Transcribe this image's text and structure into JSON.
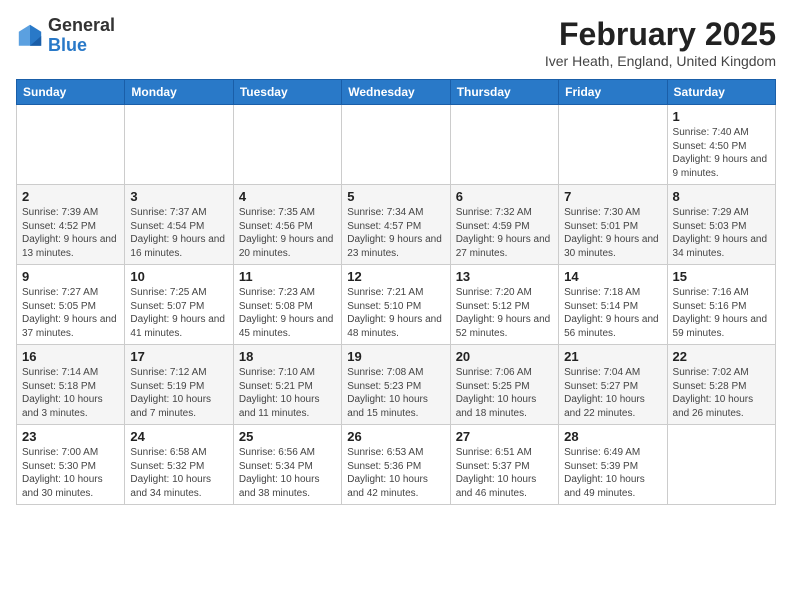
{
  "header": {
    "logo_general": "General",
    "logo_blue": "Blue",
    "month_title": "February 2025",
    "location": "Iver Heath, England, United Kingdom"
  },
  "weekdays": [
    "Sunday",
    "Monday",
    "Tuesday",
    "Wednesday",
    "Thursday",
    "Friday",
    "Saturday"
  ],
  "weeks": [
    [
      {
        "day": "",
        "info": ""
      },
      {
        "day": "",
        "info": ""
      },
      {
        "day": "",
        "info": ""
      },
      {
        "day": "",
        "info": ""
      },
      {
        "day": "",
        "info": ""
      },
      {
        "day": "",
        "info": ""
      },
      {
        "day": "1",
        "info": "Sunrise: 7:40 AM\nSunset: 4:50 PM\nDaylight: 9 hours and 9 minutes."
      }
    ],
    [
      {
        "day": "2",
        "info": "Sunrise: 7:39 AM\nSunset: 4:52 PM\nDaylight: 9 hours and 13 minutes."
      },
      {
        "day": "3",
        "info": "Sunrise: 7:37 AM\nSunset: 4:54 PM\nDaylight: 9 hours and 16 minutes."
      },
      {
        "day": "4",
        "info": "Sunrise: 7:35 AM\nSunset: 4:56 PM\nDaylight: 9 hours and 20 minutes."
      },
      {
        "day": "5",
        "info": "Sunrise: 7:34 AM\nSunset: 4:57 PM\nDaylight: 9 hours and 23 minutes."
      },
      {
        "day": "6",
        "info": "Sunrise: 7:32 AM\nSunset: 4:59 PM\nDaylight: 9 hours and 27 minutes."
      },
      {
        "day": "7",
        "info": "Sunrise: 7:30 AM\nSunset: 5:01 PM\nDaylight: 9 hours and 30 minutes."
      },
      {
        "day": "8",
        "info": "Sunrise: 7:29 AM\nSunset: 5:03 PM\nDaylight: 9 hours and 34 minutes."
      }
    ],
    [
      {
        "day": "9",
        "info": "Sunrise: 7:27 AM\nSunset: 5:05 PM\nDaylight: 9 hours and 37 minutes."
      },
      {
        "day": "10",
        "info": "Sunrise: 7:25 AM\nSunset: 5:07 PM\nDaylight: 9 hours and 41 minutes."
      },
      {
        "day": "11",
        "info": "Sunrise: 7:23 AM\nSunset: 5:08 PM\nDaylight: 9 hours and 45 minutes."
      },
      {
        "day": "12",
        "info": "Sunrise: 7:21 AM\nSunset: 5:10 PM\nDaylight: 9 hours and 48 minutes."
      },
      {
        "day": "13",
        "info": "Sunrise: 7:20 AM\nSunset: 5:12 PM\nDaylight: 9 hours and 52 minutes."
      },
      {
        "day": "14",
        "info": "Sunrise: 7:18 AM\nSunset: 5:14 PM\nDaylight: 9 hours and 56 minutes."
      },
      {
        "day": "15",
        "info": "Sunrise: 7:16 AM\nSunset: 5:16 PM\nDaylight: 9 hours and 59 minutes."
      }
    ],
    [
      {
        "day": "16",
        "info": "Sunrise: 7:14 AM\nSunset: 5:18 PM\nDaylight: 10 hours and 3 minutes."
      },
      {
        "day": "17",
        "info": "Sunrise: 7:12 AM\nSunset: 5:19 PM\nDaylight: 10 hours and 7 minutes."
      },
      {
        "day": "18",
        "info": "Sunrise: 7:10 AM\nSunset: 5:21 PM\nDaylight: 10 hours and 11 minutes."
      },
      {
        "day": "19",
        "info": "Sunrise: 7:08 AM\nSunset: 5:23 PM\nDaylight: 10 hours and 15 minutes."
      },
      {
        "day": "20",
        "info": "Sunrise: 7:06 AM\nSunset: 5:25 PM\nDaylight: 10 hours and 18 minutes."
      },
      {
        "day": "21",
        "info": "Sunrise: 7:04 AM\nSunset: 5:27 PM\nDaylight: 10 hours and 22 minutes."
      },
      {
        "day": "22",
        "info": "Sunrise: 7:02 AM\nSunset: 5:28 PM\nDaylight: 10 hours and 26 minutes."
      }
    ],
    [
      {
        "day": "23",
        "info": "Sunrise: 7:00 AM\nSunset: 5:30 PM\nDaylight: 10 hours and 30 minutes."
      },
      {
        "day": "24",
        "info": "Sunrise: 6:58 AM\nSunset: 5:32 PM\nDaylight: 10 hours and 34 minutes."
      },
      {
        "day": "25",
        "info": "Sunrise: 6:56 AM\nSunset: 5:34 PM\nDaylight: 10 hours and 38 minutes."
      },
      {
        "day": "26",
        "info": "Sunrise: 6:53 AM\nSunset: 5:36 PM\nDaylight: 10 hours and 42 minutes."
      },
      {
        "day": "27",
        "info": "Sunrise: 6:51 AM\nSunset: 5:37 PM\nDaylight: 10 hours and 46 minutes."
      },
      {
        "day": "28",
        "info": "Sunrise: 6:49 AM\nSunset: 5:39 PM\nDaylight: 10 hours and 49 minutes."
      },
      {
        "day": "",
        "info": ""
      }
    ]
  ]
}
